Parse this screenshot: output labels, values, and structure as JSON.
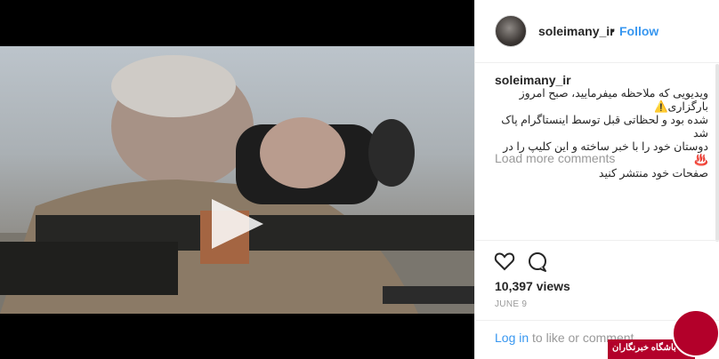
{
  "header": {
    "username": "soleimany_ir",
    "separator": "•",
    "follow_label": "Follow"
  },
  "caption": {
    "username": "soleimany_ir",
    "text": "ویدیویی که ملاحظه میفرمایید، صبح امروز بارگزاری⚠️\nشده بود و لحظاتی قبل توسط اینستاگرام پاک شد\nدوستان خود را با خبر ساخته و این کلیپ را در♨️\nصفحات خود منتشر کنید",
    "load_more": "Load more comments"
  },
  "actions": {
    "like_icon": "heart-icon",
    "comment_icon": "comment-icon",
    "views": "10,397 views",
    "date": "JUNE 9"
  },
  "login": {
    "link": "Log in",
    "rest": " to like or comment."
  },
  "watermark": {
    "text": "باشگاه خبرنگاران"
  },
  "colors": {
    "link": "#3897f0",
    "watermark": "#b3002a"
  }
}
